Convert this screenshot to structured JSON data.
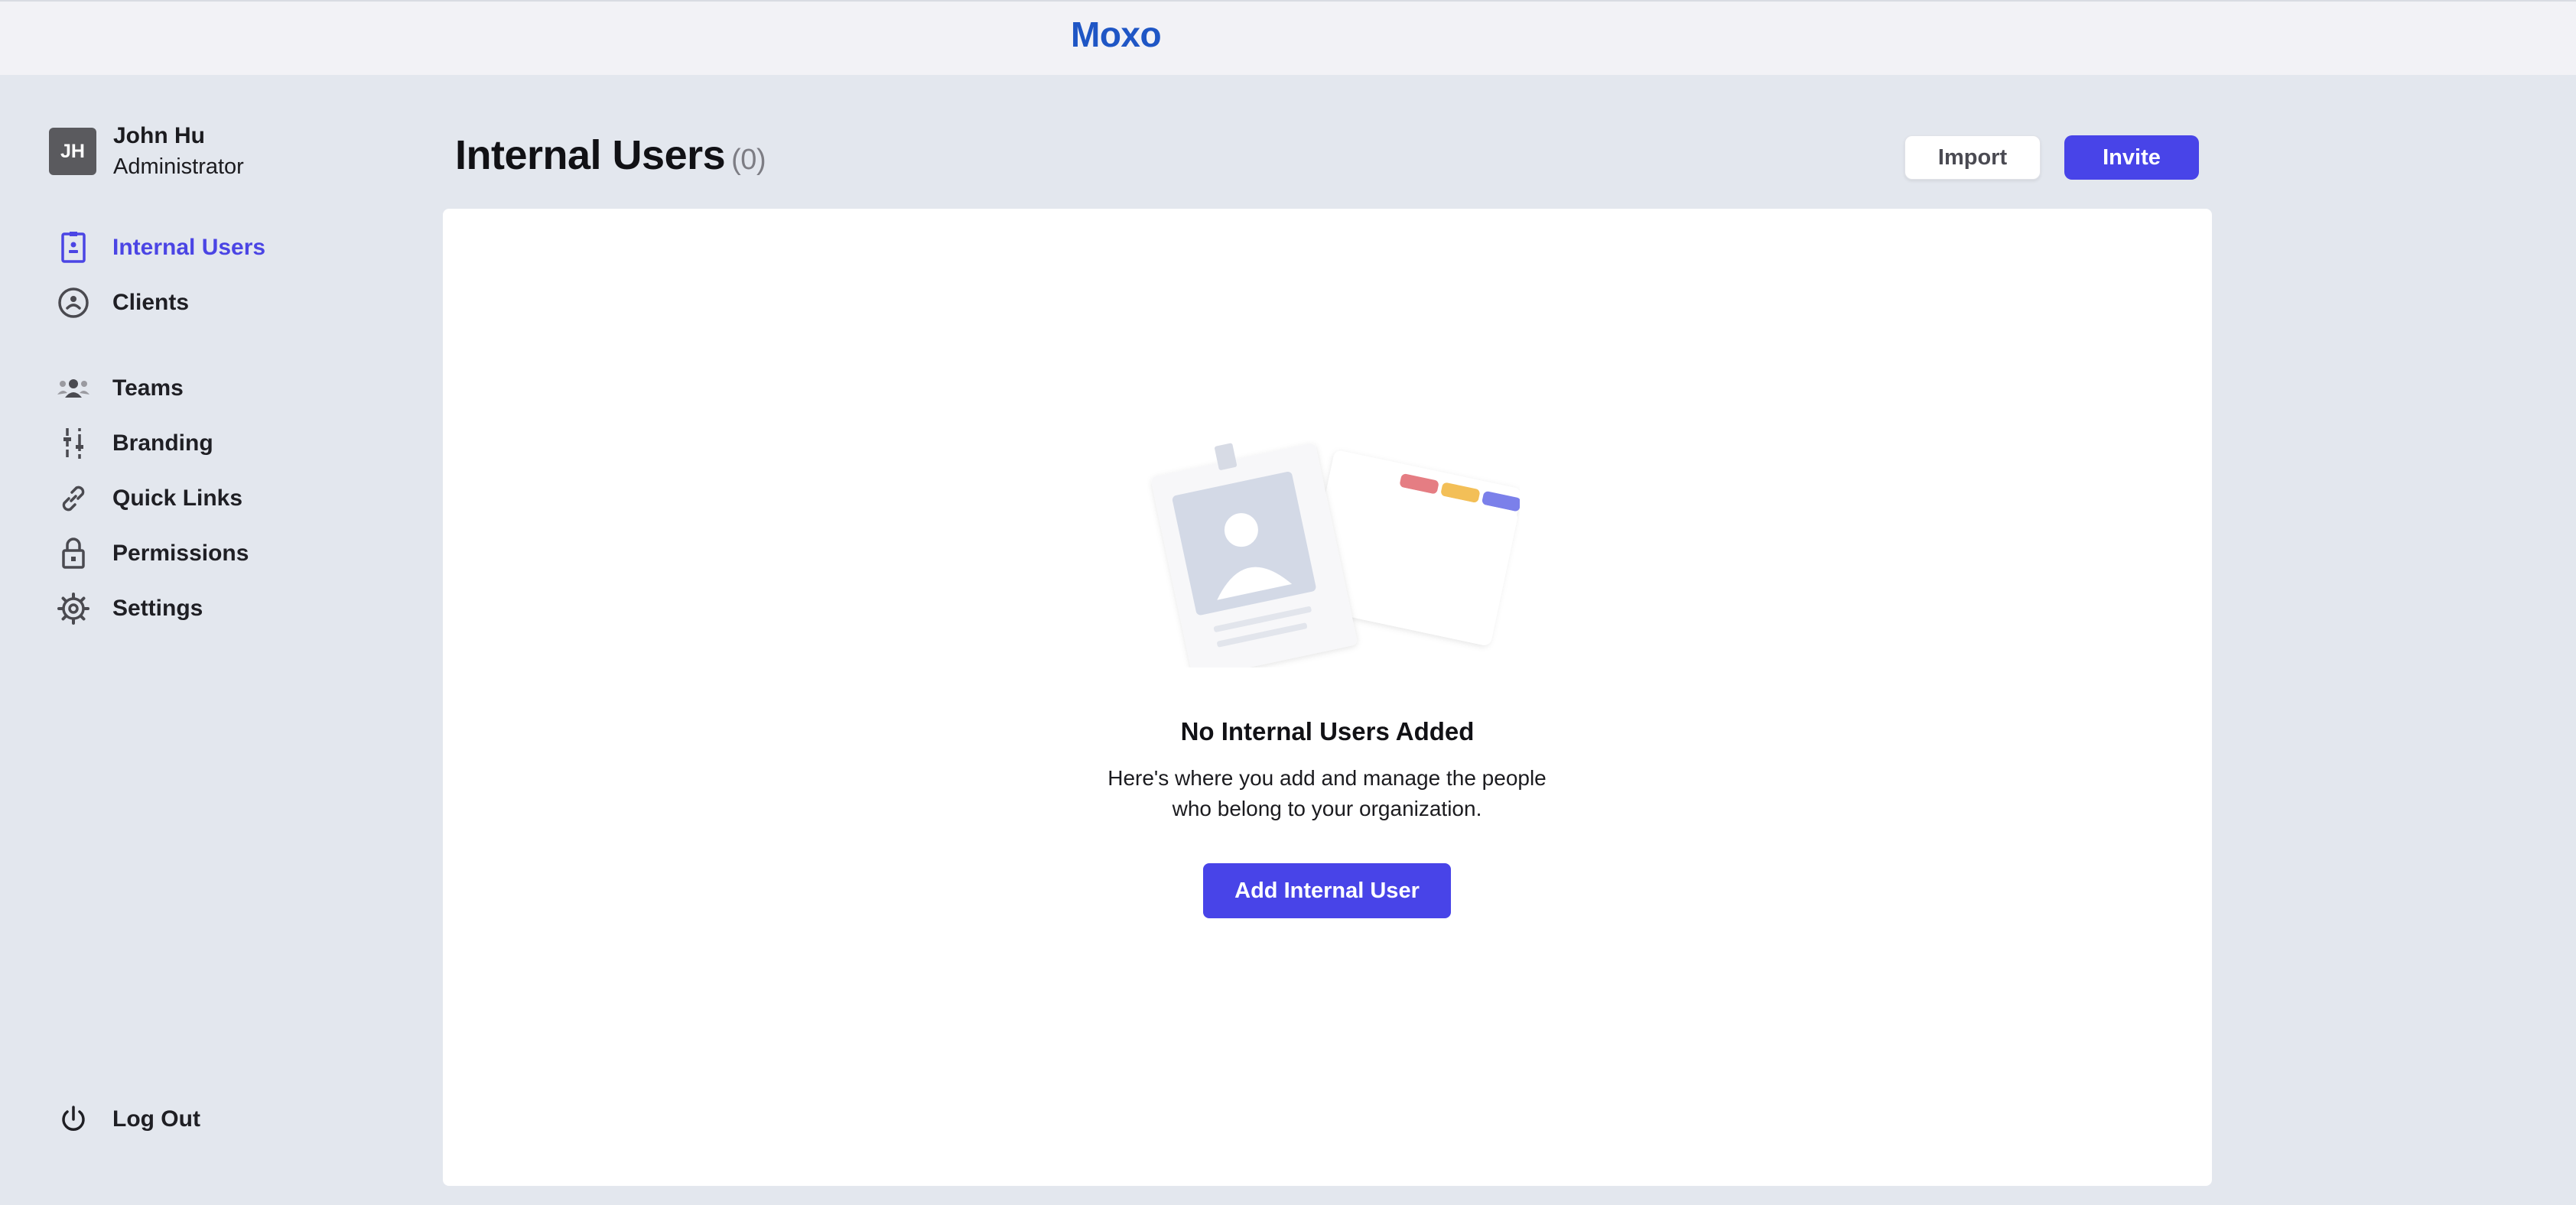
{
  "app": {
    "brand": "Moxo"
  },
  "user": {
    "initials": "JH",
    "name": "John Hu",
    "role": "Administrator"
  },
  "sidebar": {
    "items": [
      {
        "label": "Internal Users",
        "icon": "id-badge-icon",
        "active": true
      },
      {
        "label": "Clients",
        "icon": "user-circle-icon",
        "active": false
      },
      {
        "label": "Teams",
        "icon": "team-icon",
        "active": false
      },
      {
        "label": "Branding",
        "icon": "sliders-icon",
        "active": false
      },
      {
        "label": "Quick Links",
        "icon": "link-icon",
        "active": false
      },
      {
        "label": "Permissions",
        "icon": "lock-icon",
        "active": false
      },
      {
        "label": "Settings",
        "icon": "gear-icon",
        "active": false
      }
    ],
    "logout_label": "Log Out"
  },
  "header": {
    "title": "Internal Users",
    "count": "(0)",
    "import_label": "Import",
    "invite_label": "Invite"
  },
  "empty_state": {
    "title": "No Internal Users Added",
    "description": "Here's where you add and manage the people who belong to your organization.",
    "button_label": "Add Internal User"
  },
  "colors": {
    "accent": "#4844e8",
    "brand": "#1f56c5",
    "background": "#e3e7ee"
  }
}
